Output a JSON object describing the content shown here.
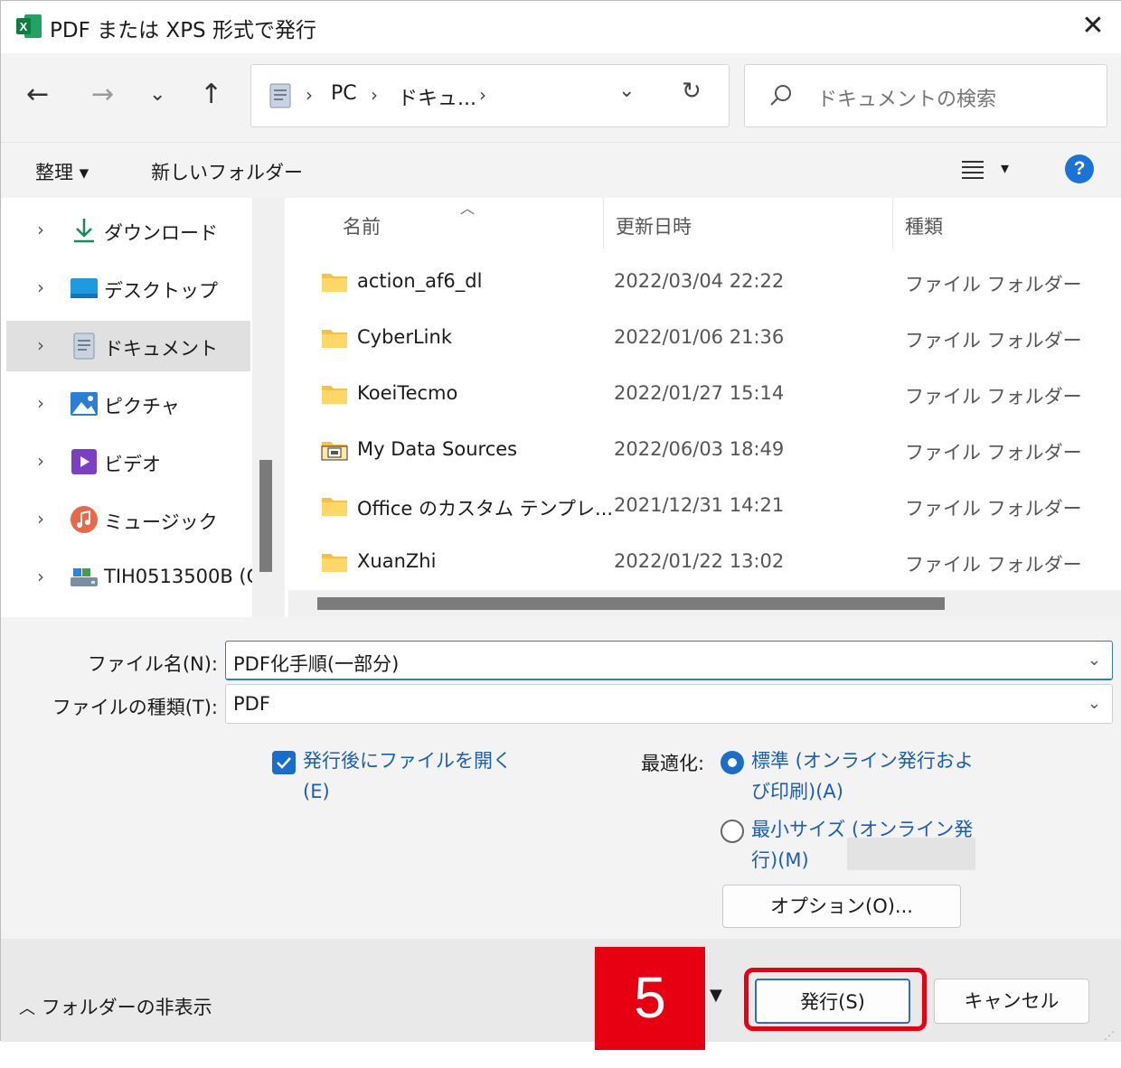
{
  "window": {
    "title": "PDF または XPS 形式で発行",
    "close_label": "✕"
  },
  "nav": {
    "back": "←",
    "forward": "→",
    "recent": "⌄",
    "up": "↑",
    "breadcrumb": [
      "PC",
      "ドキュ..."
    ],
    "dropdown": "⌄",
    "refresh": "↻",
    "search_placeholder": "ドキュメントの検索"
  },
  "toolbar": {
    "organize": "整理 ▾",
    "new_folder": "新しいフォルダー",
    "view_menu": "▾",
    "help": "?"
  },
  "sidebar": {
    "items": [
      {
        "label": "ダウンロード",
        "icon": "download-icon"
      },
      {
        "label": "デスクトップ",
        "icon": "desktop-icon"
      },
      {
        "label": "ドキュメント",
        "icon": "documents-icon",
        "selected": true
      },
      {
        "label": "ピクチャ",
        "icon": "pictures-icon"
      },
      {
        "label": "ビデオ",
        "icon": "videos-icon"
      },
      {
        "label": "ミュージック",
        "icon": "music-icon"
      },
      {
        "label": "TIH0513500B (C",
        "icon": "drive-icon"
      }
    ]
  },
  "files": {
    "columns": {
      "name": "名前",
      "date": "更新日時",
      "type": "種類"
    },
    "rows": [
      {
        "name": "action_af6_dl",
        "date": "2022/03/04 22:22",
        "type": "ファイル フォルダー"
      },
      {
        "name": "CyberLink",
        "date": "2022/01/06 21:36",
        "type": "ファイル フォルダー"
      },
      {
        "name": "KoeiTecmo",
        "date": "2022/01/27 15:14",
        "type": "ファイル フォルダー"
      },
      {
        "name": "My Data Sources",
        "date": "2022/06/03 18:49",
        "type": "ファイル フォルダー"
      },
      {
        "name": "Office のカスタム テンプレ...",
        "date": "2021/12/31 14:21",
        "type": "ファイル フォルダー"
      },
      {
        "name": "XuanZhi",
        "date": "2022/01/22 13:02",
        "type": "ファイル フォルダー"
      }
    ]
  },
  "form": {
    "filename_label": "ファイル名(N):",
    "filename_value": "PDF化手順(一部分)",
    "filetype_label": "ファイルの種類(T):",
    "filetype_value": "PDF",
    "open_after_line1": "発行後にファイルを開く",
    "open_after_line2": "(E)",
    "optimize_label": "最適化:",
    "opt_standard_line1": "標準 (オンライン発行およ",
    "opt_standard_line2": "び印刷)(A)",
    "opt_min_line1": "最小サイズ (オンライン発",
    "opt_min_line2": "行)(M)",
    "options_button": "オプション(O)..."
  },
  "footer": {
    "hide_folders": "フォルダーの非表示",
    "step_number": "5",
    "publish_button": "発行(S)",
    "cancel_button": "キャンセル"
  },
  "colors": {
    "accent": "#1a6dc9",
    "annotation_red": "#e60012"
  }
}
